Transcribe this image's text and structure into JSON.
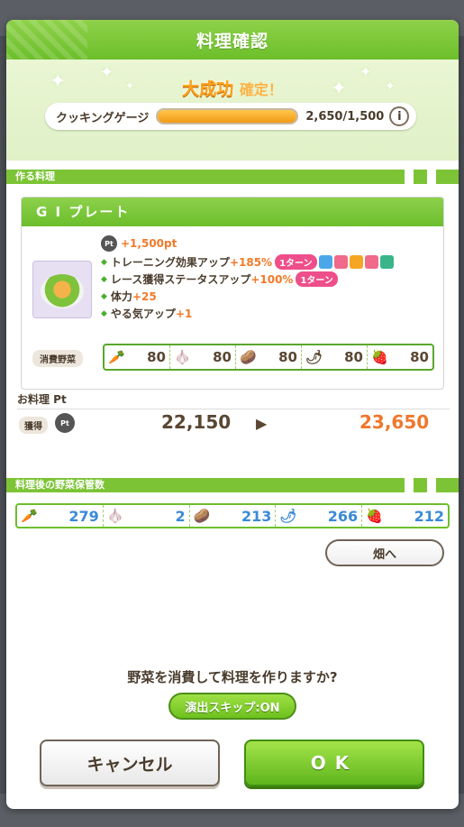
{
  "dialog": {
    "title": "料理確認",
    "result_main": "大成功",
    "result_sub": "確定！"
  },
  "gauge": {
    "label": "クッキングゲージ",
    "value_text": "2,650/1,500",
    "fill_fraction": 1.0,
    "info_label": "i"
  },
  "recipe_section": {
    "header": "作る料理",
    "name": "G I プレート",
    "pt_gain": "+1,500pt",
    "pt_badge": "Pt",
    "effects": [
      {
        "label": "トレーニング効果アップ",
        "value": "+185%",
        "turn": "1ターン"
      },
      {
        "label": "レース獲得ステータスアップ",
        "value": "+100%",
        "turn": "1ターン"
      },
      {
        "label": "体力",
        "value": "+25"
      },
      {
        "label": "やる気アップ",
        "value": "+1"
      }
    ],
    "stat_icon_colors": [
      "#4aa8e8",
      "#f06a8a",
      "#f5a623",
      "#f06a8a",
      "#3ab58a"
    ],
    "consume_label": "消費野菜",
    "consume": [
      {
        "icon": "carrot-icon",
        "glyph": "🥕",
        "value": "80"
      },
      {
        "icon": "garlic-icon",
        "glyph": "🧄",
        "value": "80"
      },
      {
        "icon": "potato-icon",
        "glyph": "🥔",
        "value": "80"
      },
      {
        "icon": "pepper-icon",
        "glyph": "🌶",
        "value": "80"
      },
      {
        "icon": "strawberry-icon",
        "glyph": "🍓",
        "value": "80"
      }
    ]
  },
  "points": {
    "header": "お料理 Pt",
    "acquire_label": "獲得",
    "badge": "Pt",
    "before": "22,150",
    "after": "23,650"
  },
  "stock_section": {
    "header": "料理後の野菜保管数",
    "items": [
      {
        "icon": "carrot-icon",
        "glyph": "🥕",
        "value": "279"
      },
      {
        "icon": "garlic-icon",
        "glyph": "🧄",
        "value": "2"
      },
      {
        "icon": "potato-icon",
        "glyph": "🥔",
        "value": "213"
      },
      {
        "icon": "pepper-icon",
        "glyph": "🌶",
        "value": "266"
      },
      {
        "icon": "strawberry-icon",
        "glyph": "🍓",
        "value": "212"
      }
    ]
  },
  "buttons": {
    "field": "畑へ",
    "question": "野菜を消費して料理を作りますか?",
    "skip": "演出スキップ:ON",
    "cancel": "キャンセル",
    "ok": "OK"
  }
}
